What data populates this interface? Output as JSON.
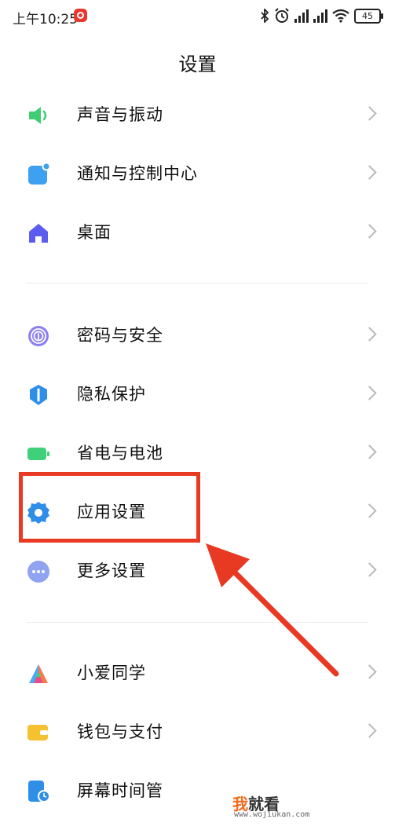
{
  "status_bar": {
    "time": "上午10:25",
    "battery": "45"
  },
  "header": {
    "title": "设置"
  },
  "items": [
    {
      "label": "声音与振动",
      "icon": "speaker-icon",
      "color": "#3fce73"
    },
    {
      "label": "通知与控制中心",
      "icon": "notification-icon",
      "color": "#3ea0f0"
    },
    {
      "label": "桌面",
      "icon": "home-icon",
      "color": "#5c5cf0"
    },
    {
      "label": "密码与安全",
      "icon": "fingerprint-icon",
      "color": "#8b7ff0"
    },
    {
      "label": "隐私保护",
      "icon": "privacy-shield-icon",
      "color": "#2f8fe8"
    },
    {
      "label": "省电与电池",
      "icon": "battery-icon",
      "color": "#3fd079"
    },
    {
      "label": "应用设置",
      "icon": "gear-icon",
      "color": "#2f8fe8"
    },
    {
      "label": "更多设置",
      "icon": "more-dots-icon",
      "color": "#8fa3f0"
    },
    {
      "label": "小爱同学",
      "icon": "xiaoai-icon",
      "color": "#e94a8a"
    },
    {
      "label": "钱包与支付",
      "icon": "wallet-icon",
      "color": "#f5c131"
    },
    {
      "label": "屏幕时间管",
      "icon": "screen-time-icon",
      "color": "#2f8fe8"
    }
  ],
  "annotation": {
    "highlight_color": "#e83a23"
  },
  "watermark": {
    "first_char": "我",
    "rest": "就看",
    "url": "www.wojiukan.com"
  }
}
